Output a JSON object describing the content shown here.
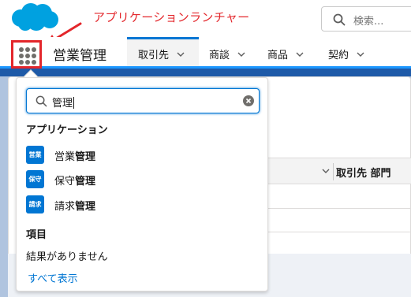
{
  "annotation": {
    "label": "アプリケーションランチャー",
    "color": "#e3262b"
  },
  "header": {
    "logo_icon": "salesforce-cloud-icon",
    "search": {
      "placeholder": "検索...",
      "icon": "search-icon"
    }
  },
  "navbar": {
    "launcher_icon": "app-launcher-waffle-icon",
    "app_name": "営業管理",
    "tabs": [
      {
        "label": "取引先",
        "active": true
      },
      {
        "label": "商談",
        "active": false
      },
      {
        "label": "商品",
        "active": false
      },
      {
        "label": "契約",
        "active": false
      }
    ]
  },
  "background_table": {
    "column_header": "取引先 部門"
  },
  "launcher_dropdown": {
    "search_value": "管理",
    "apps_section_title": "アプリケーション",
    "apps": [
      {
        "badge": "営業",
        "name_plain": "営業",
        "name_bold": "管理"
      },
      {
        "badge": "保守",
        "name_plain": "保守",
        "name_bold": "管理"
      },
      {
        "badge": "請求",
        "name_plain": "請求",
        "name_bold": "管理"
      }
    ],
    "items_section_title": "項目",
    "no_results": "結果がありません",
    "show_all": "すべて表示"
  },
  "colors": {
    "brand_blue": "#0176d3",
    "salesforce_logo": "#00a1e0",
    "highlight_red": "#e3262b"
  }
}
